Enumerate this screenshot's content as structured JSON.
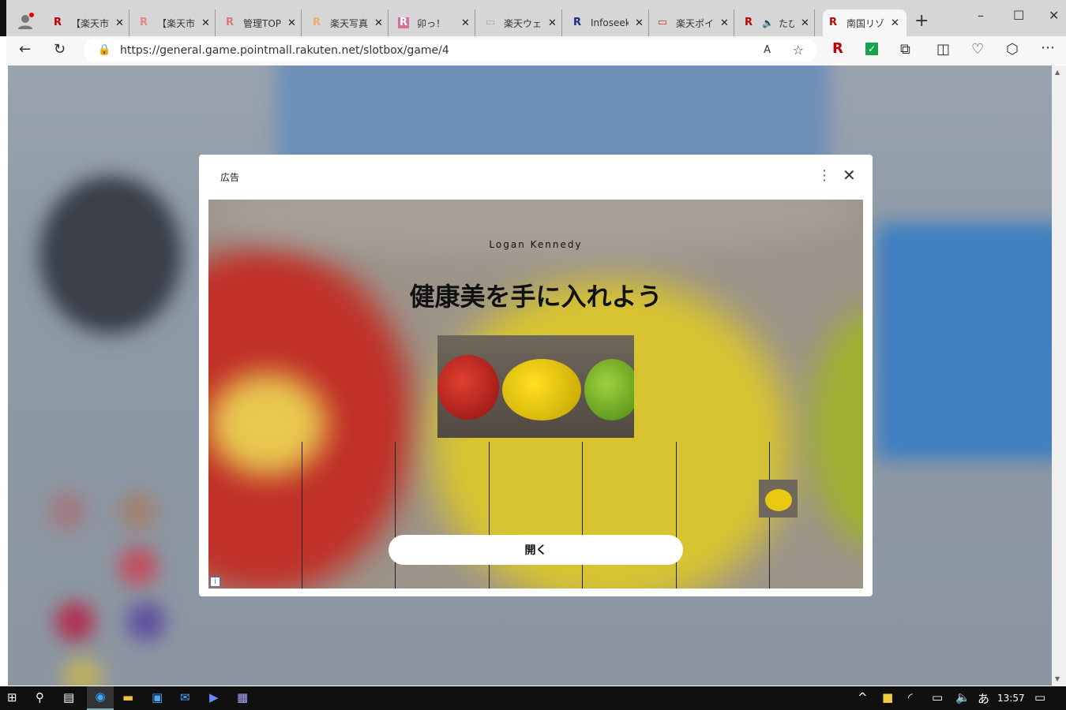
{
  "browser": {
    "tabs": [
      {
        "label": "【楽天市場",
        "fav": "R"
      },
      {
        "label": "【楽天市場",
        "fav": "R"
      },
      {
        "label": "管理TOP",
        "fav": "R"
      },
      {
        "label": "楽天写真",
        "fav": "R"
      },
      {
        "label": "卯っ！",
        "fav": "R"
      },
      {
        "label": "楽天ウェブ",
        "fav": "▭"
      },
      {
        "label": "Infoseek",
        "fav": "R"
      },
      {
        "label": "楽天ポイ",
        "fav": "▭"
      },
      {
        "label": "たび",
        "fav": "R"
      },
      {
        "label": "南国リゾ",
        "fav": "R"
      }
    ],
    "new_tab": "+",
    "minimize": "–",
    "maximize": "☐",
    "close": "✕",
    "url": "https://general.game.pointmall.rakuten.net/slotbox/game/4"
  },
  "ad": {
    "label": "広告",
    "brand": "Logan Kennedy",
    "headline": "健康美を手に入れよう",
    "open_button": "開く",
    "info": "i"
  },
  "taskbar": {
    "ime": "あ",
    "time": "13:57"
  }
}
